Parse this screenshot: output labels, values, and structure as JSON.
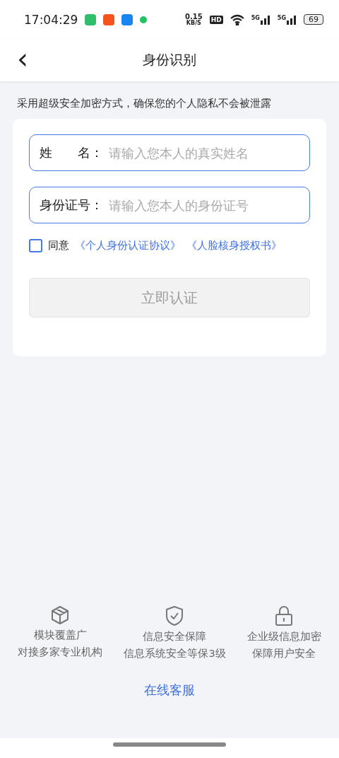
{
  "status_bar": {
    "time": "17:04:29",
    "net_speed": "0.15",
    "net_unit": "KB/S",
    "hd": "HD",
    "signals": [
      "5G",
      "5G"
    ],
    "battery": "69"
  },
  "header": {
    "back": "‹",
    "title": "身份识别"
  },
  "notice": "采用超级安全加密方式，确保您的个人隐私不会被泄露",
  "form": {
    "fields": [
      {
        "label": "姓　　名：",
        "placeholder": "请输入您本人的真实姓名"
      },
      {
        "label": "身份证号：",
        "placeholder": "请输入您本人的身份证号"
      }
    ],
    "agreement": {
      "checked": false,
      "text": "同意",
      "links": [
        "《个人身份认证协议》",
        "《人脸核身授权书》"
      ]
    },
    "submit": {
      "label": "立即认证",
      "disabled": true
    }
  },
  "features": [
    {
      "kind": "cube",
      "lines": [
        "模块覆盖广",
        "对接多家专业机构"
      ]
    },
    {
      "kind": "shield",
      "lines": [
        "信息安全保障",
        "信息系统安全等保3级"
      ]
    },
    {
      "kind": "lock",
      "lines": [
        "企业级信息加密",
        "保障用户安全"
      ]
    }
  ],
  "support_link": "在线客服"
}
